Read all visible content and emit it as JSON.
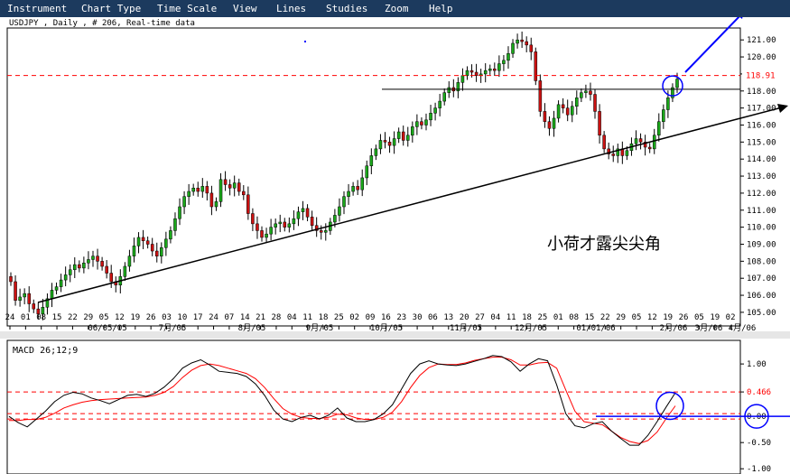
{
  "menu": {
    "items": [
      "Instrument",
      "Chart Type",
      "Time Scale",
      "View",
      "Lines",
      "Studies",
      "Zoom",
      "Help"
    ]
  },
  "chart_data": [
    {
      "type": "candlestick",
      "title": "USDJPY , Daily , # 206, Real-time data",
      "annotation": "小荷才露尖尖角",
      "y_ticks": [
        "121.00",
        "120.00",
        "119.00",
        "118.00",
        "117.00",
        "116.00",
        "115.00",
        "114.00",
        "113.00",
        "112.00",
        "111.00",
        "110.00",
        "109.00",
        "108.00",
        "107.00",
        "106.00",
        "105.00"
      ],
      "ylim": [
        104.2,
        121.7
      ],
      "price_level": "118.91",
      "day_ticks": [
        "24",
        "01",
        "08",
        "15",
        "22",
        "29",
        "05",
        "12",
        "19",
        "26",
        "03",
        "10",
        "17",
        "24",
        "07",
        "14",
        "21",
        "28",
        "04",
        "11",
        "18",
        "25",
        "02",
        "09",
        "16",
        "23",
        "30",
        "06",
        "13",
        "20",
        "27",
        "04",
        "11",
        "18",
        "25",
        "01",
        "08",
        "15",
        "22",
        "29",
        "05",
        "12",
        "19",
        "26",
        "05",
        "19",
        "02"
      ],
      "month_labels": [
        "06/05/05",
        "7月/05",
        "8月/05",
        "9月/05",
        "10月/05",
        "11月/05",
        "12月/05",
        "01/01/06",
        "2月/06",
        "3月/06",
        "4月/06"
      ],
      "close_approx": [
        106.8,
        105.7,
        105.9,
        106.1,
        105.5,
        105.2,
        104.9,
        105.3,
        105.8,
        106.3,
        106.5,
        106.9,
        107.2,
        107.5,
        107.8,
        107.6,
        107.9,
        108.1,
        108.3,
        108.0,
        107.7,
        107.3,
        106.8,
        106.6,
        107.1,
        107.7,
        108.3,
        108.9,
        109.4,
        109.2,
        109.0,
        108.6,
        108.3,
        108.8,
        109.3,
        109.8,
        110.5,
        111.2,
        111.8,
        112.1,
        112.3,
        112.1,
        112.4,
        112.0,
        111.2,
        111.5,
        112.8,
        112.5,
        112.3,
        112.6,
        112.1,
        111.9,
        110.8,
        110.2,
        109.8,
        109.4,
        109.6,
        110.0,
        110.2,
        110.3,
        110.0,
        110.2,
        110.5,
        110.9,
        111.1,
        110.6,
        110.1,
        109.8,
        109.7,
        109.8,
        110.3,
        110.7,
        111.2,
        111.8,
        112.1,
        112.4,
        112.2,
        112.9,
        113.6,
        114.2,
        114.6,
        115.1,
        115.0,
        114.8,
        115.2,
        115.6,
        115.1,
        115.4,
        115.9,
        116.2,
        116.0,
        116.3,
        116.7,
        117.0,
        117.4,
        117.9,
        118.2,
        118.0,
        118.5,
        118.9,
        119.2,
        119.1,
        118.9,
        119.0,
        119.2,
        119.3,
        119.2,
        119.6,
        119.8,
        120.2,
        120.8,
        121.0,
        120.9,
        120.7,
        120.3,
        118.6,
        116.8,
        116.2,
        115.8,
        116.4,
        117.2,
        117.0,
        116.6,
        117.1,
        117.6,
        117.9,
        118.0,
        117.8,
        116.8,
        115.4,
        114.6,
        114.3,
        114.2,
        114.6,
        114.2,
        114.5,
        114.9,
        115.2,
        115.0,
        114.7,
        114.6,
        115.4,
        116.2,
        116.9,
        117.6,
        118.2,
        118.7
      ]
    },
    {
      "type": "line",
      "title": "MACD 26;12;9",
      "y_ticks": [
        "1.00",
        "0.466",
        "0.00",
        "-0.50",
        "-1.00"
      ],
      "ylim": [
        -1.1,
        1.45
      ],
      "series": [
        {
          "color": "#000000",
          "values": [
            0.0,
            -0.12,
            -0.2,
            -0.05,
            0.1,
            0.28,
            0.4,
            0.46,
            0.43,
            0.35,
            0.3,
            0.24,
            0.32,
            0.4,
            0.42,
            0.38,
            0.44,
            0.56,
            0.72,
            0.92,
            1.02,
            1.08,
            0.98,
            0.86,
            0.84,
            0.82,
            0.76,
            0.62,
            0.4,
            0.12,
            -0.05,
            -0.1,
            -0.02,
            0.02,
            -0.05,
            0.02,
            0.16,
            -0.03,
            -0.1,
            -0.1,
            -0.06,
            0.05,
            0.22,
            0.52,
            0.82,
            1.0,
            1.06,
            1.0,
            0.98,
            0.97,
            1.0,
            1.05,
            1.1,
            1.16,
            1.14,
            1.04,
            0.86,
            1.0,
            1.1,
            1.06,
            0.6,
            0.05,
            -0.18,
            -0.22,
            -0.14,
            -0.1,
            -0.28,
            -0.42,
            -0.55,
            -0.55,
            -0.36,
            -0.1,
            0.18,
            0.45
          ]
        },
        {
          "color": "#ff0000",
          "values": [
            -0.08,
            -0.08,
            -0.06,
            -0.06,
            -0.02,
            0.06,
            0.16,
            0.22,
            0.27,
            0.3,
            0.32,
            0.33,
            0.34,
            0.35,
            0.36,
            0.37,
            0.4,
            0.46,
            0.57,
            0.74,
            0.88,
            0.97,
            1.0,
            0.97,
            0.92,
            0.87,
            0.82,
            0.72,
            0.55,
            0.34,
            0.15,
            0.04,
            -0.02,
            -0.04,
            -0.04,
            -0.02,
            0.04,
            0.03,
            -0.03,
            -0.06,
            -0.06,
            -0.02,
            0.08,
            0.28,
            0.55,
            0.78,
            0.93,
            1.0,
            0.99,
            0.99,
            1.02,
            1.07,
            1.1,
            1.13,
            1.13,
            1.08,
            0.98,
            0.98,
            1.02,
            1.03,
            0.92,
            0.5,
            0.1,
            -0.1,
            -0.13,
            -0.16,
            -0.28,
            -0.4,
            -0.48,
            -0.52,
            -0.46,
            -0.3,
            -0.04,
            0.2
          ]
        }
      ]
    }
  ]
}
